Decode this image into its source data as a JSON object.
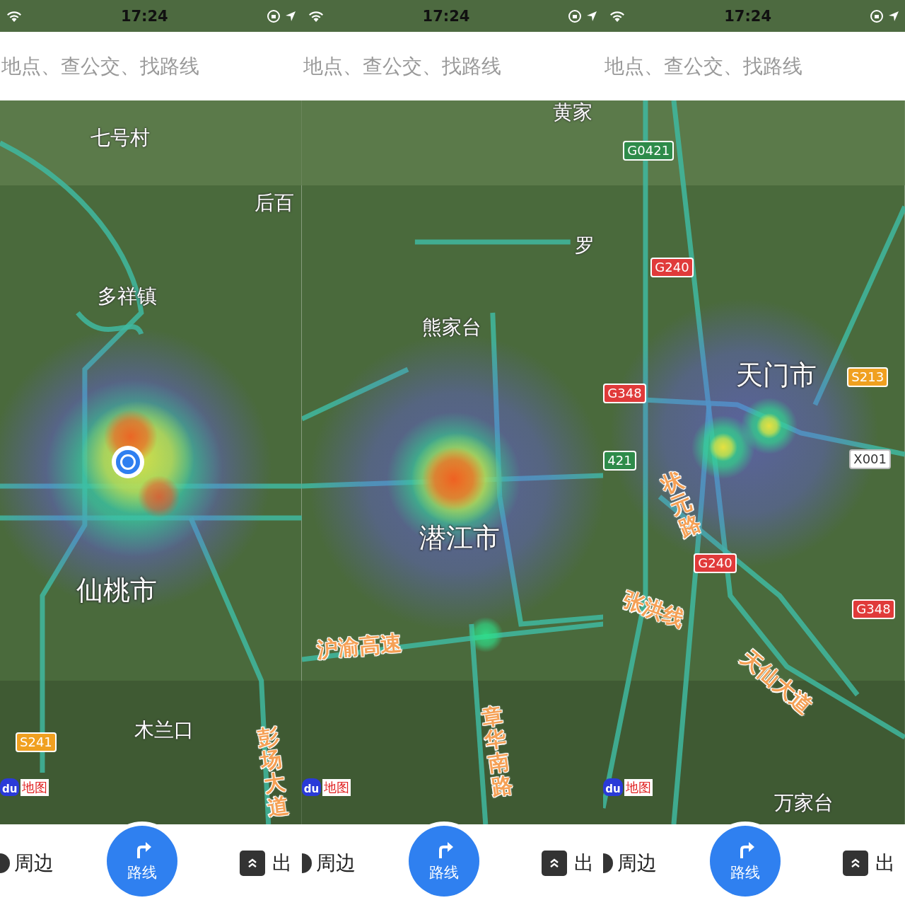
{
  "panels": [
    {
      "status_bar": {
        "time": "17:24"
      },
      "search": {
        "placeholder": "地点、查公交、找路线"
      },
      "map": {
        "show_location": true,
        "logo": {
          "mark": "du",
          "text": "地图"
        },
        "labels": [
          {
            "text": "七号村",
            "kind": "place"
          },
          {
            "text": "后百",
            "kind": "place"
          },
          {
            "text": "多祥镇",
            "kind": "place"
          },
          {
            "text": "仙桃市",
            "kind": "city"
          },
          {
            "text": "S241",
            "kind": "shield",
            "color": "#f0a020"
          },
          {
            "text": "木兰口",
            "kind": "place"
          },
          {
            "text": "彭场大道",
            "kind": "road"
          }
        ]
      },
      "bottom_bar": {
        "left": "周边",
        "center": "路线",
        "right": "出"
      }
    },
    {
      "status_bar": {
        "time": "17:24"
      },
      "search": {
        "placeholder": "地点、查公交、找路线"
      },
      "map": {
        "show_location": false,
        "logo": {
          "mark": "du",
          "text": "地图"
        },
        "labels": [
          {
            "text": "黄家",
            "kind": "place"
          },
          {
            "text": "罗",
            "kind": "place"
          },
          {
            "text": "熊家台",
            "kind": "place"
          },
          {
            "text": "潜江市",
            "kind": "city"
          },
          {
            "text": "沪渝高速",
            "kind": "road"
          },
          {
            "text": "章华南路",
            "kind": "road"
          }
        ]
      },
      "bottom_bar": {
        "left": "周边",
        "center": "路线",
        "right": "出"
      }
    },
    {
      "status_bar": {
        "time": "17:24"
      },
      "search": {
        "placeholder": "地点、查公交、找路线"
      },
      "map": {
        "show_location": false,
        "logo": {
          "mark": "du",
          "text": "地图"
        },
        "labels": [
          {
            "text": "G0421",
            "kind": "shield",
            "color": "#2e8b4a"
          },
          {
            "text": "G240",
            "kind": "shield",
            "color": "#e03a3a"
          },
          {
            "text": "G348",
            "kind": "shield",
            "color": "#e03a3a"
          },
          {
            "text": "天门市",
            "kind": "city"
          },
          {
            "text": "S213",
            "kind": "shield",
            "color": "#f0a020"
          },
          {
            "text": "421",
            "kind": "shield",
            "color": "#2e8b4a"
          },
          {
            "text": "X001",
            "kind": "shield",
            "color": "#ffffff"
          },
          {
            "text": "状元路",
            "kind": "road"
          },
          {
            "text": "G240",
            "kind": "shield",
            "color": "#e03a3a"
          },
          {
            "text": "张洪线",
            "kind": "road"
          },
          {
            "text": "天仙大道",
            "kind": "road"
          },
          {
            "text": "G348",
            "kind": "shield",
            "color": "#e03a3a"
          },
          {
            "text": "万家台",
            "kind": "place"
          }
        ]
      },
      "bottom_bar": {
        "left": "周边",
        "center": "路线",
        "right": "出"
      }
    }
  ]
}
